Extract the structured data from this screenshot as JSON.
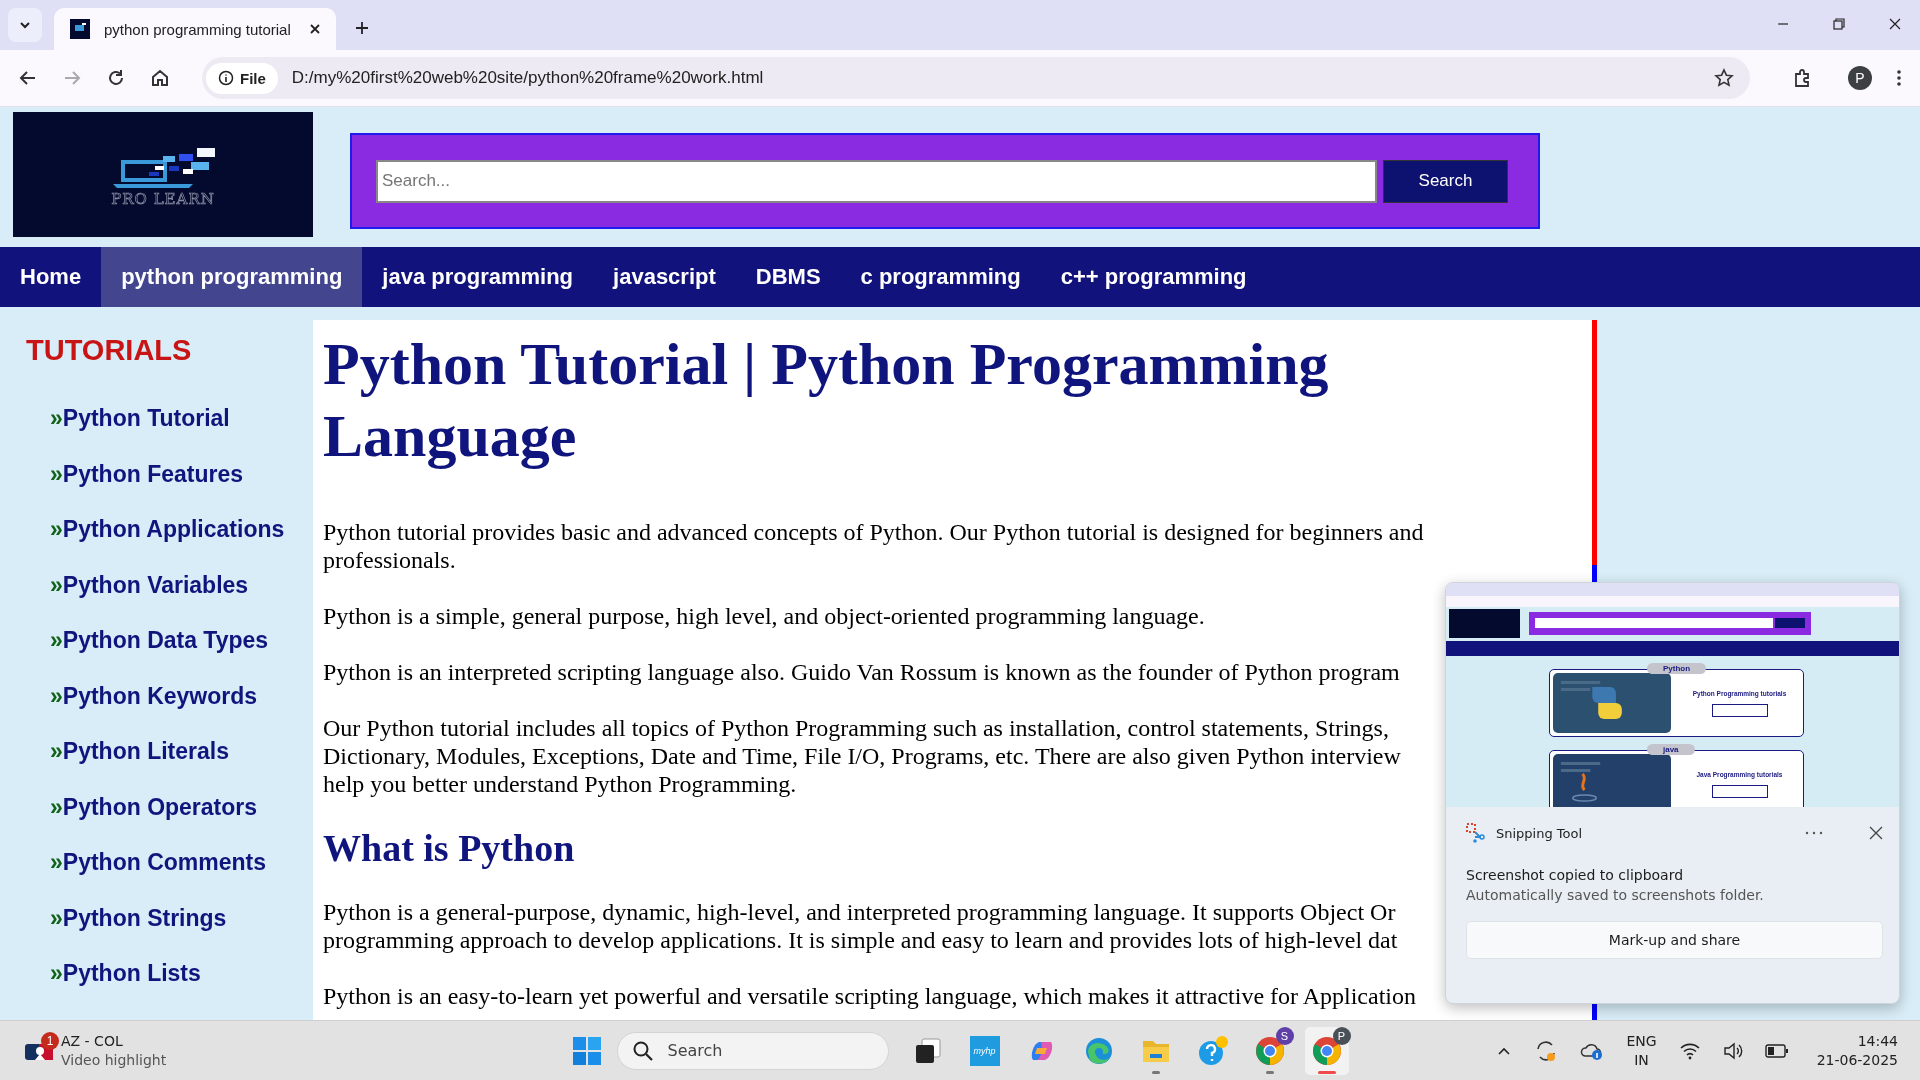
{
  "browser": {
    "tab": {
      "title": "python programming tutorial"
    },
    "address": {
      "chip": "File",
      "url": "D:/my%20first%20web%20site/python%20frame%20work.html"
    },
    "profile": "P"
  },
  "site": {
    "logo": "PRO LEARN",
    "search": {
      "placeholder": "Search...",
      "button": "Search"
    },
    "nav": [
      {
        "label": "Home",
        "selected": false
      },
      {
        "label": "python programming",
        "selected": true
      },
      {
        "label": "java programming",
        "selected": false
      },
      {
        "label": "javascript",
        "selected": false
      },
      {
        "label": "DBMS",
        "selected": false
      },
      {
        "label": "c programming",
        "selected": false
      },
      {
        "label": "c++ programming",
        "selected": false
      }
    ],
    "sidebar": {
      "title": "TUTORIALS",
      "items": [
        {
          "marker": "»",
          "label": "Python Tutorial"
        },
        {
          "marker": "»",
          "label": "Python Features"
        },
        {
          "marker": "»",
          "label": "Python Applications"
        },
        {
          "marker": "»",
          "label": "Python Variables"
        },
        {
          "marker": "»",
          "label": "Python Data Types"
        },
        {
          "marker": "»",
          "label": "Python Keywords"
        },
        {
          "marker": "»",
          "label": "Python Literals"
        },
        {
          "marker": "»",
          "label": "Python Operators"
        },
        {
          "marker": "»",
          "label": "Python Comments"
        },
        {
          "marker": "»",
          "label": "Python Strings"
        },
        {
          "marker": "»",
          "label": "Python Lists"
        }
      ]
    },
    "article": {
      "title": "Python Tutorial | Python Programming Language",
      "blocks": [
        {
          "kind": "paragraph",
          "lines": [
            "Python tutorial provides basic and advanced concepts of Python. Our Python tutorial is designed for beginners and",
            "professionals."
          ]
        },
        {
          "kind": "paragraph",
          "lines": [
            "Python is a simple, general purpose, high level, and object-oriented programming language."
          ]
        },
        {
          "kind": "paragraph",
          "lines": [
            "Python is an interpreted scripting language also. Guido Van Rossum is known as the founder of Python program"
          ]
        },
        {
          "kind": "paragraph",
          "lines": [
            "Our Python tutorial includes all topics of Python Programming such as installation, control statements, Strings,",
            "Dictionary, Modules, Exceptions, Date and Time, File I/O, Programs, etc. There are also given Python interview",
            "help you better understand Python Programming."
          ]
        },
        {
          "kind": "heading",
          "lines": [
            "What is Python"
          ]
        },
        {
          "kind": "paragraph",
          "lines": [
            "Python is a general-purpose, dynamic, high-level, and interpreted programming language. It supports Object Or",
            "programming approach to develop applications. It is simple and easy to learn and provides lots of high-level dat"
          ]
        },
        {
          "kind": "paragraph",
          "lines": [
            "Python is an easy-to-learn yet powerful and versatile scripting language, which makes it attractive for Application"
          ]
        }
      ]
    }
  },
  "snip": {
    "preview": {
      "cards": [
        {
          "tag": "Python",
          "title": "Python Programming tutorials",
          "kind": "picture"
        },
        {
          "tag": "java",
          "title": "Java Programming tutorials",
          "kind": "picture"
        }
      ]
    },
    "app": "Snipping Tool",
    "title": "Screenshot copied to clipboard",
    "message": "Automatically saved to screenshots folder.",
    "button": "Mark-up and share"
  },
  "taskbar": {
    "widget": {
      "badge": "1",
      "title": "AZ - COL",
      "subtitle": "Video highlight"
    },
    "search": {
      "placeholder": "Search"
    },
    "apps": [
      {
        "kind": "taskview",
        "running": false,
        "active": false
      },
      {
        "kind": "myhp",
        "label": "myhp",
        "running": false,
        "active": false
      },
      {
        "kind": "copilot",
        "running": false,
        "active": false
      },
      {
        "kind": "edge",
        "running": false,
        "active": false
      },
      {
        "kind": "explorer",
        "running": true,
        "active": false
      },
      {
        "kind": "help",
        "running": false,
        "active": false
      },
      {
        "kind": "chrome",
        "badge": "S",
        "running": true,
        "active": false
      },
      {
        "kind": "chrome",
        "badge": "P",
        "running": true,
        "active": true
      }
    ],
    "language": [
      "ENG",
      "IN"
    ],
    "time": "14:44",
    "date": "21-06-2025"
  }
}
